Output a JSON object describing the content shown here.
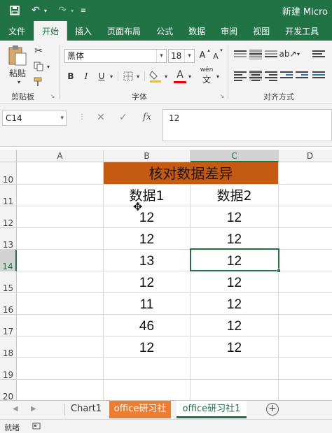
{
  "window": {
    "title": "新建 Micro"
  },
  "quick_access": {
    "save_icon": "save-icon",
    "undo_icon": "undo-icon",
    "redo_icon": "redo-icon",
    "customize_icon": "customize-icon"
  },
  "tabs": [
    "文件",
    "开始",
    "插入",
    "页面布局",
    "公式",
    "数据",
    "审阅",
    "视图",
    "开发工具"
  ],
  "active_tab": "开始",
  "ribbon": {
    "clipboard": {
      "paste_label": "粘贴",
      "group_label": "剪贴板",
      "icons": [
        "cut-icon",
        "copy-icon",
        "format-painter-icon"
      ]
    },
    "font": {
      "font_name": "黑体",
      "font_size": "18",
      "grow_label": "A",
      "shrink_label": "A",
      "bold": "B",
      "italic": "I",
      "underline": "U",
      "font_color_label": "A",
      "phonetic_label": "wén",
      "group_label": "字体"
    },
    "alignment": {
      "group_label": "对齐方式"
    }
  },
  "formula_bar": {
    "name_box": "C14",
    "cancel": "✕",
    "enter": "✓",
    "fx": "fx",
    "content": "12"
  },
  "grid": {
    "columns": [
      "A",
      "B",
      "C",
      "D"
    ],
    "selected_column": "C",
    "rows": [
      {
        "num": "10",
        "b": "核对数据差异",
        "c": ""
      },
      {
        "num": "11",
        "b": "数据1",
        "c": "数据2"
      },
      {
        "num": "12",
        "b": "12",
        "c": "12"
      },
      {
        "num": "13",
        "b": "12",
        "c": "12"
      },
      {
        "num": "14",
        "b": "13",
        "c": "12"
      },
      {
        "num": "15",
        "b": "12",
        "c": "12"
      },
      {
        "num": "16",
        "b": "11",
        "c": "12"
      },
      {
        "num": "17",
        "b": "46",
        "c": "12"
      },
      {
        "num": "18",
        "b": "12",
        "c": "12"
      },
      {
        "num": "19",
        "b": "",
        "c": ""
      },
      {
        "num": "20",
        "b": "",
        "c": ""
      }
    ],
    "title_fill": "#c55a11",
    "selected_cell": "C14"
  },
  "sheets": [
    "Chart1",
    "office研习社",
    "office研习社1"
  ],
  "active_sheet": "office研习社1",
  "status": {
    "ready": "就绪"
  },
  "colors": {
    "brand": "#217346",
    "tab_orange": "#ed7d31"
  }
}
